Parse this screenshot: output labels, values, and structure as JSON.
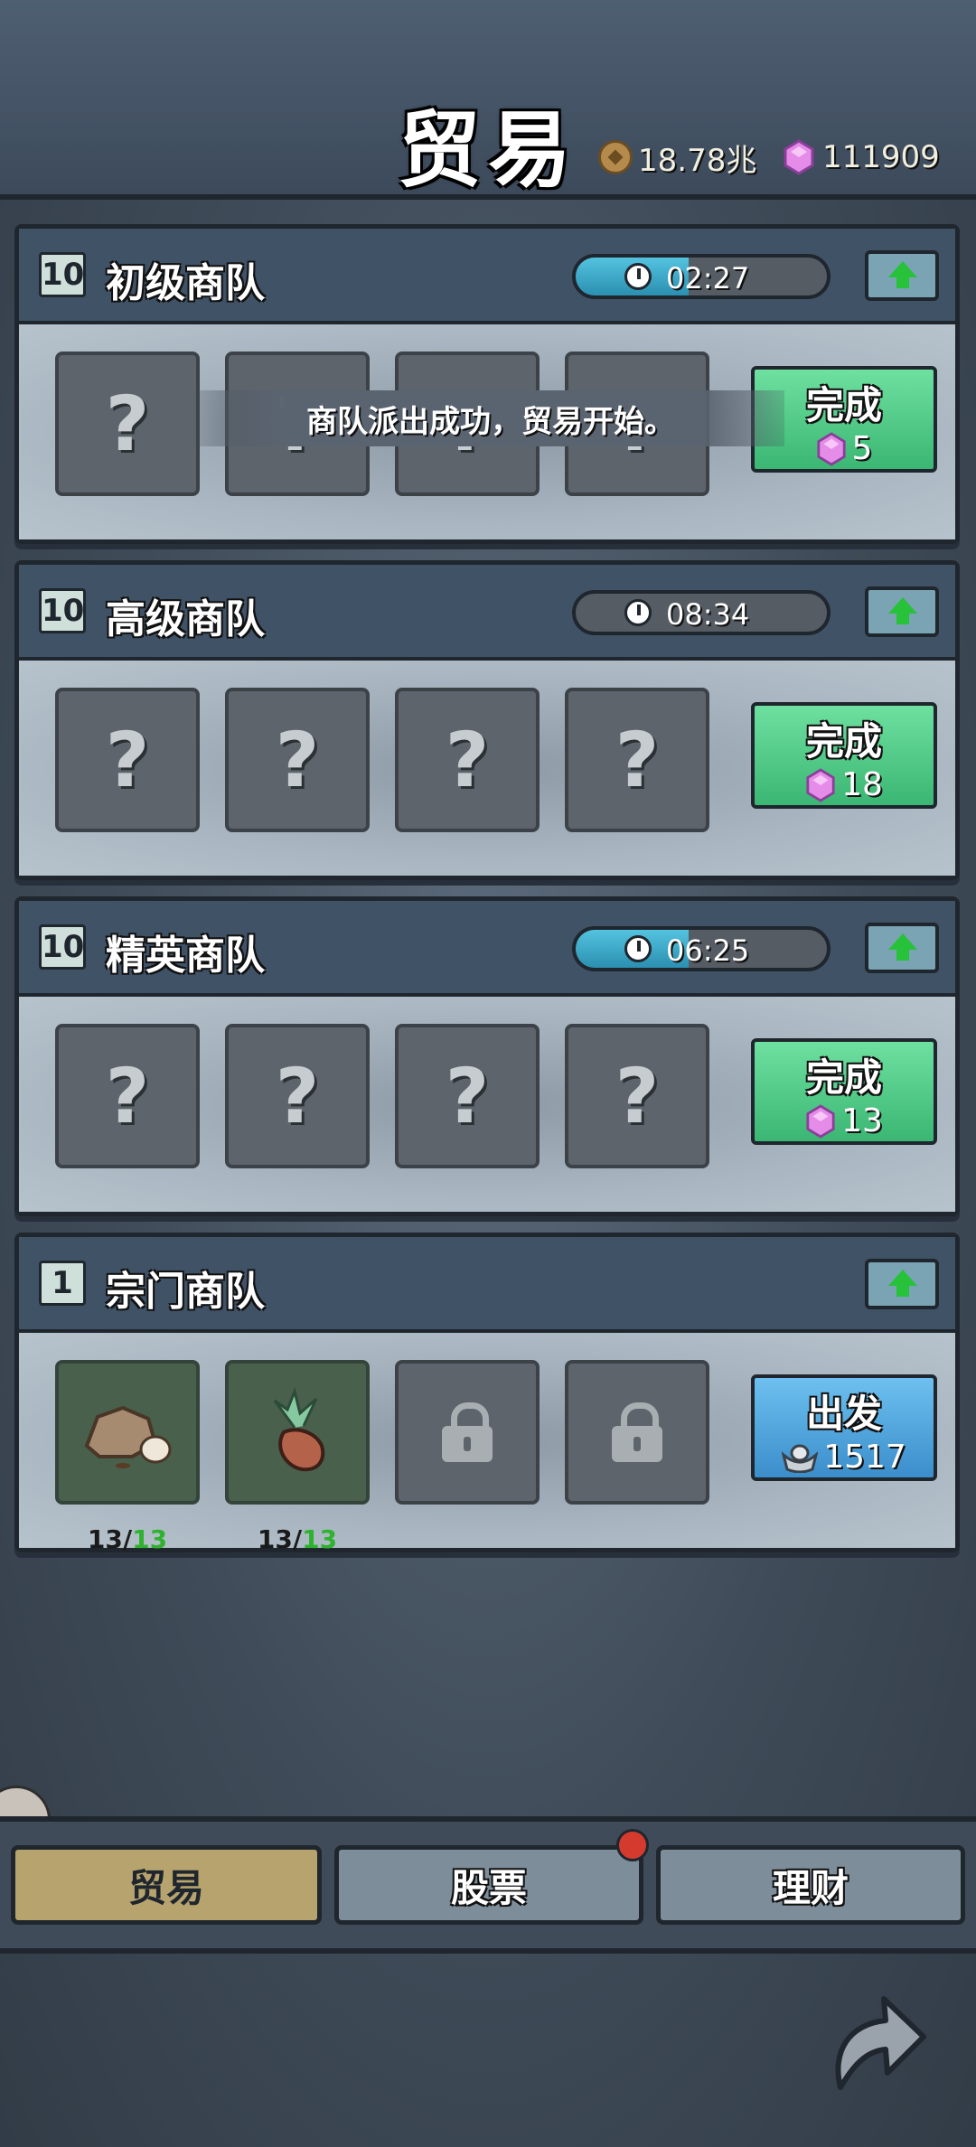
{
  "header": {
    "title": "贸易",
    "coin_amount": "18.78兆",
    "gem_amount": "111909"
  },
  "toast": "商队派出成功，贸易开始。",
  "caravans": [
    {
      "level": "10",
      "name": "初级商队",
      "timer": "02:27",
      "timer_progress": 0.45,
      "action": "完成",
      "cost": "5",
      "cost_type": "gem"
    },
    {
      "level": "10",
      "name": "高级商队",
      "timer": "08:34",
      "timer_progress": 0.0,
      "action": "完成",
      "cost": "18",
      "cost_type": "gem"
    },
    {
      "level": "10",
      "name": "精英商队",
      "timer": "06:25",
      "timer_progress": 0.45,
      "action": "完成",
      "cost": "13",
      "cost_type": "gem"
    },
    {
      "level": "1",
      "name": "宗门商队",
      "action": "出发",
      "cost": "1517",
      "cost_type": "silver",
      "items": [
        {
          "name": "stone",
          "count": "13",
          "max": "13"
        },
        {
          "name": "herb",
          "count": "13",
          "max": "13"
        }
      ]
    }
  ],
  "slot_unknown": "?",
  "count_sep": "/",
  "tabs": [
    {
      "label": "贸易",
      "active": true
    },
    {
      "label": "股票",
      "active": false,
      "badge": true
    },
    {
      "label": "理财",
      "active": false
    }
  ],
  "colors": {
    "green_button": "#3bb673",
    "blue_button": "#3b8ecb",
    "timer_fill": "#2b8fb0",
    "active_tab": "#b7a36e"
  }
}
